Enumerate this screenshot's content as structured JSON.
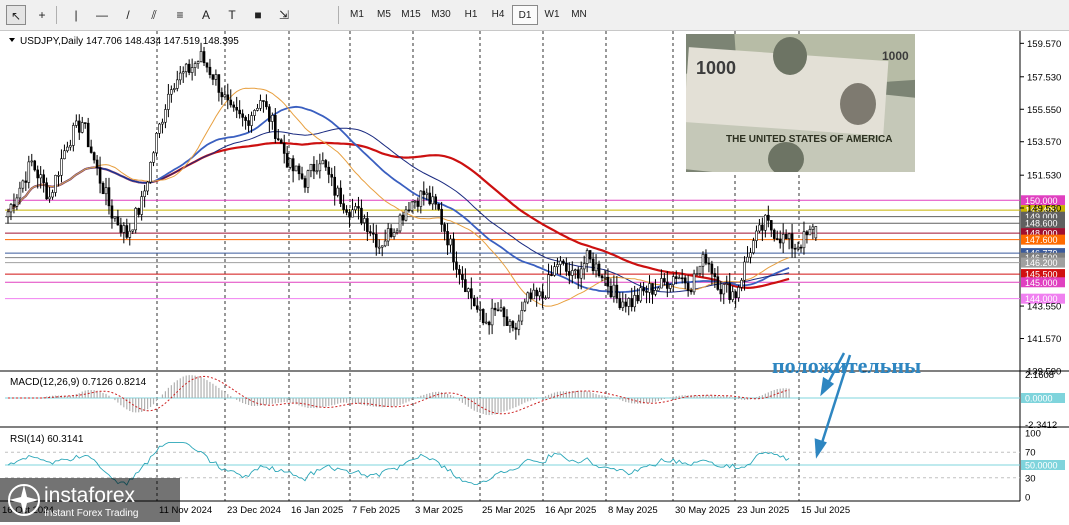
{
  "toolbar": {
    "tools": [
      {
        "name": "cursor-tool-icon",
        "glyph": "↖"
      },
      {
        "name": "crosshair-tool-icon",
        "glyph": "+"
      },
      {
        "name": "vertical-line-tool-icon",
        "glyph": "|"
      },
      {
        "name": "horizontal-line-tool-icon",
        "glyph": "—"
      },
      {
        "name": "trendline-tool-icon",
        "glyph": "/"
      },
      {
        "name": "channel-tool-icon",
        "glyph": "⫽"
      },
      {
        "name": "fibonacci-tool-icon",
        "glyph": "≡"
      },
      {
        "name": "text-tool-icon",
        "glyph": "A"
      },
      {
        "name": "label-tool-icon",
        "glyph": "T"
      },
      {
        "name": "rectangle-tool-icon",
        "glyph": "■"
      },
      {
        "name": "arrows-tool-icon",
        "glyph": "⇲"
      }
    ],
    "timeframes": [
      "M1",
      "M5",
      "M15",
      "M30",
      "H1",
      "H4",
      "D1",
      "W1",
      "MN"
    ],
    "active_timeframe": "D1"
  },
  "chart_data": [
    {
      "type": "candlestick",
      "title": "USDJPY,Daily  147.706 148.434 147.519 148.395",
      "symbol": "USDJPY",
      "timeframe": "Daily",
      "ohlc": {
        "open": 147.706,
        "high": 148.434,
        "low": 147.519,
        "close": 148.395
      },
      "ylim": [
        139.59,
        160.2
      ],
      "y_ticks": [
        "159.570",
        "157.530",
        "155.550",
        "153.570",
        "151.530",
        "149.530",
        "143.550",
        "141.570",
        "139.590"
      ],
      "x_tick_labels": [
        "16 Oct 2024",
        "11 Nov 2024",
        "23 Dec 2024",
        "16 Jan 2025",
        "7 Feb 2025",
        "3 Mar 2025",
        "25 Mar 2025",
        "16 Apr 2025",
        "8 May 2025",
        "30 May 2025",
        "23 Jun 2025",
        "15 Jul 2025"
      ],
      "price_levels": [
        {
          "price": 150.0,
          "label": "150.000",
          "color": "#e040c0"
        },
        {
          "price": 149.4,
          "label": "149.400",
          "color": "#c8b400"
        },
        {
          "price": 149.0,
          "label": "149.000",
          "color": "#606060"
        },
        {
          "price": 148.6,
          "label": "148.600",
          "color": "#606060"
        },
        {
          "price": 148.0,
          "label": "148.000",
          "color": "#a01030"
        },
        {
          "price": 147.6,
          "label": "147.600",
          "color": "#ff6a00"
        },
        {
          "price": 146.779,
          "label": "146.779",
          "color": "#3a5a9c"
        },
        {
          "price": 146.5,
          "label": "146.500",
          "color": "#808080"
        },
        {
          "price": 146.2,
          "label": "146.200",
          "color": "#a0a0a0"
        },
        {
          "price": 145.5,
          "label": "145.500",
          "color": "#d01010"
        },
        {
          "price": 145.0,
          "label": "145.000",
          "color": "#e040c0"
        },
        {
          "price": 144.0,
          "label": "144.000",
          "color": "#f080f0"
        }
      ],
      "close_anchors": [
        [
          0,
          149.3
        ],
        [
          8,
          152.3
        ],
        [
          14,
          150.2
        ],
        [
          20,
          153.6
        ],
        [
          25,
          154.8
        ],
        [
          30,
          151.8
        ],
        [
          35,
          149.2
        ],
        [
          40,
          147.9
        ],
        [
          45,
          149.8
        ],
        [
          50,
          153.8
        ],
        [
          55,
          157.2
        ],
        [
          60,
          157.8
        ],
        [
          65,
          158.7
        ],
        [
          70,
          157.4
        ],
        [
          75,
          155.3
        ],
        [
          80,
          154.8
        ],
        [
          85,
          156.2
        ],
        [
          90,
          154.3
        ],
        [
          95,
          152.0
        ],
        [
          100,
          151.2
        ],
        [
          105,
          152.6
        ],
        [
          110,
          150.6
        ],
        [
          115,
          149.5
        ],
        [
          120,
          148.9
        ],
        [
          125,
          147.3
        ],
        [
          130,
          148.4
        ],
        [
          135,
          149.8
        ],
        [
          140,
          150.4
        ],
        [
          145,
          149.3
        ],
        [
          150,
          146.7
        ],
        [
          155,
          144.5
        ],
        [
          160,
          142.5
        ],
        [
          165,
          143.3
        ],
        [
          170,
          141.8
        ],
        [
          175,
          143.9
        ],
        [
          180,
          144.1
        ],
        [
          185,
          146.2
        ],
        [
          190,
          145.3
        ],
        [
          195,
          146.4
        ],
        [
          200,
          145.6
        ],
        [
          205,
          144.0
        ],
        [
          210,
          143.8
        ],
        [
          215,
          144.5
        ],
        [
          220,
          144.8
        ],
        [
          225,
          145.5
        ],
        [
          230,
          144.9
        ],
        [
          235,
          146.6
        ],
        [
          240,
          144.7
        ],
        [
          245,
          144.3
        ],
        [
          250,
          147.1
        ],
        [
          255,
          148.6
        ],
        [
          260,
          147.8
        ],
        [
          265,
          147.2
        ],
        [
          270,
          147.9
        ],
        [
          272,
          148.4
        ]
      ],
      "moving_averages": [
        {
          "name": "ma-red",
          "color": "#cc1010"
        },
        {
          "name": "ma-blue",
          "color": "#3a5fc0"
        },
        {
          "name": "ma-darkblue",
          "color": "#1a2a80"
        },
        {
          "name": "ma-orange",
          "color": "#e8a040"
        }
      ]
    },
    {
      "type": "bar",
      "title": "MACD(12,26,9) 0.7126 0.8214",
      "y_ticks": [
        "2.1608",
        "0.0000",
        "-2.3412"
      ],
      "ylim": [
        -2.3412,
        2.1608
      ],
      "zero_level_label": "0.0000",
      "bar_color": "#b0b0b0",
      "signal_color": "#cc2020"
    },
    {
      "type": "line",
      "title": "RSI(14) 60.3141",
      "value": 60.3141,
      "y_ticks": [
        "100",
        "70",
        "50",
        "30",
        "0"
      ],
      "ylim": [
        0,
        100
      ],
      "highlight_level_label": "50.0000",
      "line_color": "#2aa6b8"
    }
  ],
  "annotation": {
    "text": "положительны",
    "color": "#2e86c1"
  },
  "watermark": {
    "brand": "instaforex",
    "tagline": "Instant Forex Trading"
  }
}
